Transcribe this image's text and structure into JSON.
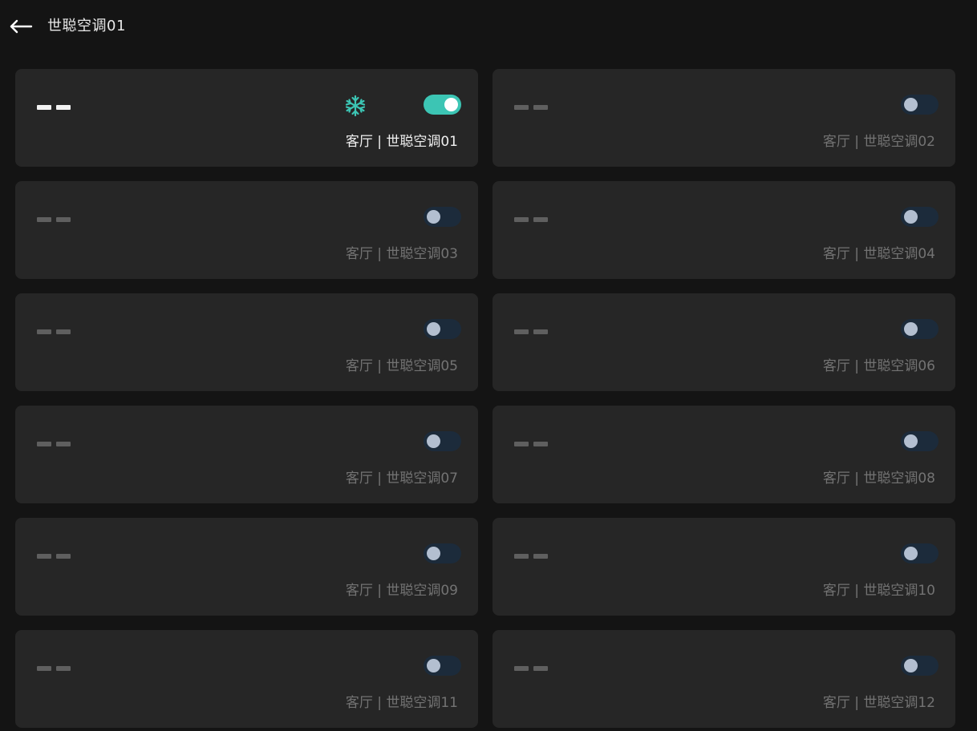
{
  "header": {
    "title": "世聪空调01",
    "back_icon": "arrow-left-icon"
  },
  "colors": {
    "background": "#141414",
    "card": "#262626",
    "accent": "#3cc5b4",
    "toggle_off": "#1c2b3b"
  },
  "active_mode_icon": "snowflake-icon",
  "devices": [
    {
      "label": "客厅 | 世聪空调01",
      "temperature": "--",
      "on": true
    },
    {
      "label": "客厅 | 世聪空调02",
      "temperature": "--",
      "on": false
    },
    {
      "label": "客厅 | 世聪空调03",
      "temperature": "--",
      "on": false
    },
    {
      "label": "客厅 | 世聪空调04",
      "temperature": "--",
      "on": false
    },
    {
      "label": "客厅 | 世聪空调05",
      "temperature": "--",
      "on": false
    },
    {
      "label": "客厅 | 世聪空调06",
      "temperature": "--",
      "on": false
    },
    {
      "label": "客厅 | 世聪空调07",
      "temperature": "--",
      "on": false
    },
    {
      "label": "客厅 | 世聪空调08",
      "temperature": "--",
      "on": false
    },
    {
      "label": "客厅 | 世聪空调09",
      "temperature": "--",
      "on": false
    },
    {
      "label": "客厅 | 世聪空调10",
      "temperature": "--",
      "on": false
    },
    {
      "label": "客厅 | 世聪空调11",
      "temperature": "--",
      "on": false
    },
    {
      "label": "客厅 | 世聪空调12",
      "temperature": "--",
      "on": false
    }
  ]
}
